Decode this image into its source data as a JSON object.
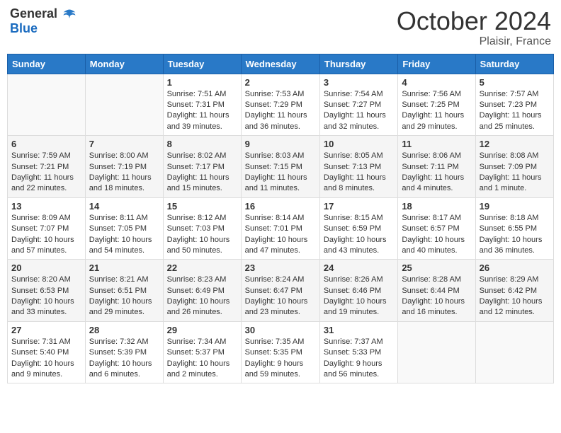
{
  "header": {
    "logo_general": "General",
    "logo_blue": "Blue",
    "month": "October 2024",
    "location": "Plaisir, France"
  },
  "weekdays": [
    "Sunday",
    "Monday",
    "Tuesday",
    "Wednesday",
    "Thursday",
    "Friday",
    "Saturday"
  ],
  "weeks": [
    [
      {
        "day": "",
        "info": ""
      },
      {
        "day": "",
        "info": ""
      },
      {
        "day": "1",
        "info": "Sunrise: 7:51 AM\nSunset: 7:31 PM\nDaylight: 11 hours and 39 minutes."
      },
      {
        "day": "2",
        "info": "Sunrise: 7:53 AM\nSunset: 7:29 PM\nDaylight: 11 hours and 36 minutes."
      },
      {
        "day": "3",
        "info": "Sunrise: 7:54 AM\nSunset: 7:27 PM\nDaylight: 11 hours and 32 minutes."
      },
      {
        "day": "4",
        "info": "Sunrise: 7:56 AM\nSunset: 7:25 PM\nDaylight: 11 hours and 29 minutes."
      },
      {
        "day": "5",
        "info": "Sunrise: 7:57 AM\nSunset: 7:23 PM\nDaylight: 11 hours and 25 minutes."
      }
    ],
    [
      {
        "day": "6",
        "info": "Sunrise: 7:59 AM\nSunset: 7:21 PM\nDaylight: 11 hours and 22 minutes."
      },
      {
        "day": "7",
        "info": "Sunrise: 8:00 AM\nSunset: 7:19 PM\nDaylight: 11 hours and 18 minutes."
      },
      {
        "day": "8",
        "info": "Sunrise: 8:02 AM\nSunset: 7:17 PM\nDaylight: 11 hours and 15 minutes."
      },
      {
        "day": "9",
        "info": "Sunrise: 8:03 AM\nSunset: 7:15 PM\nDaylight: 11 hours and 11 minutes."
      },
      {
        "day": "10",
        "info": "Sunrise: 8:05 AM\nSunset: 7:13 PM\nDaylight: 11 hours and 8 minutes."
      },
      {
        "day": "11",
        "info": "Sunrise: 8:06 AM\nSunset: 7:11 PM\nDaylight: 11 hours and 4 minutes."
      },
      {
        "day": "12",
        "info": "Sunrise: 8:08 AM\nSunset: 7:09 PM\nDaylight: 11 hours and 1 minute."
      }
    ],
    [
      {
        "day": "13",
        "info": "Sunrise: 8:09 AM\nSunset: 7:07 PM\nDaylight: 10 hours and 57 minutes."
      },
      {
        "day": "14",
        "info": "Sunrise: 8:11 AM\nSunset: 7:05 PM\nDaylight: 10 hours and 54 minutes."
      },
      {
        "day": "15",
        "info": "Sunrise: 8:12 AM\nSunset: 7:03 PM\nDaylight: 10 hours and 50 minutes."
      },
      {
        "day": "16",
        "info": "Sunrise: 8:14 AM\nSunset: 7:01 PM\nDaylight: 10 hours and 47 minutes."
      },
      {
        "day": "17",
        "info": "Sunrise: 8:15 AM\nSunset: 6:59 PM\nDaylight: 10 hours and 43 minutes."
      },
      {
        "day": "18",
        "info": "Sunrise: 8:17 AM\nSunset: 6:57 PM\nDaylight: 10 hours and 40 minutes."
      },
      {
        "day": "19",
        "info": "Sunrise: 8:18 AM\nSunset: 6:55 PM\nDaylight: 10 hours and 36 minutes."
      }
    ],
    [
      {
        "day": "20",
        "info": "Sunrise: 8:20 AM\nSunset: 6:53 PM\nDaylight: 10 hours and 33 minutes."
      },
      {
        "day": "21",
        "info": "Sunrise: 8:21 AM\nSunset: 6:51 PM\nDaylight: 10 hours and 29 minutes."
      },
      {
        "day": "22",
        "info": "Sunrise: 8:23 AM\nSunset: 6:49 PM\nDaylight: 10 hours and 26 minutes."
      },
      {
        "day": "23",
        "info": "Sunrise: 8:24 AM\nSunset: 6:47 PM\nDaylight: 10 hours and 23 minutes."
      },
      {
        "day": "24",
        "info": "Sunrise: 8:26 AM\nSunset: 6:46 PM\nDaylight: 10 hours and 19 minutes."
      },
      {
        "day": "25",
        "info": "Sunrise: 8:28 AM\nSunset: 6:44 PM\nDaylight: 10 hours and 16 minutes."
      },
      {
        "day": "26",
        "info": "Sunrise: 8:29 AM\nSunset: 6:42 PM\nDaylight: 10 hours and 12 minutes."
      }
    ],
    [
      {
        "day": "27",
        "info": "Sunrise: 7:31 AM\nSunset: 5:40 PM\nDaylight: 10 hours and 9 minutes."
      },
      {
        "day": "28",
        "info": "Sunrise: 7:32 AM\nSunset: 5:39 PM\nDaylight: 10 hours and 6 minutes."
      },
      {
        "day": "29",
        "info": "Sunrise: 7:34 AM\nSunset: 5:37 PM\nDaylight: 10 hours and 2 minutes."
      },
      {
        "day": "30",
        "info": "Sunrise: 7:35 AM\nSunset: 5:35 PM\nDaylight: 9 hours and 59 minutes."
      },
      {
        "day": "31",
        "info": "Sunrise: 7:37 AM\nSunset: 5:33 PM\nDaylight: 9 hours and 56 minutes."
      },
      {
        "day": "",
        "info": ""
      },
      {
        "day": "",
        "info": ""
      }
    ]
  ]
}
